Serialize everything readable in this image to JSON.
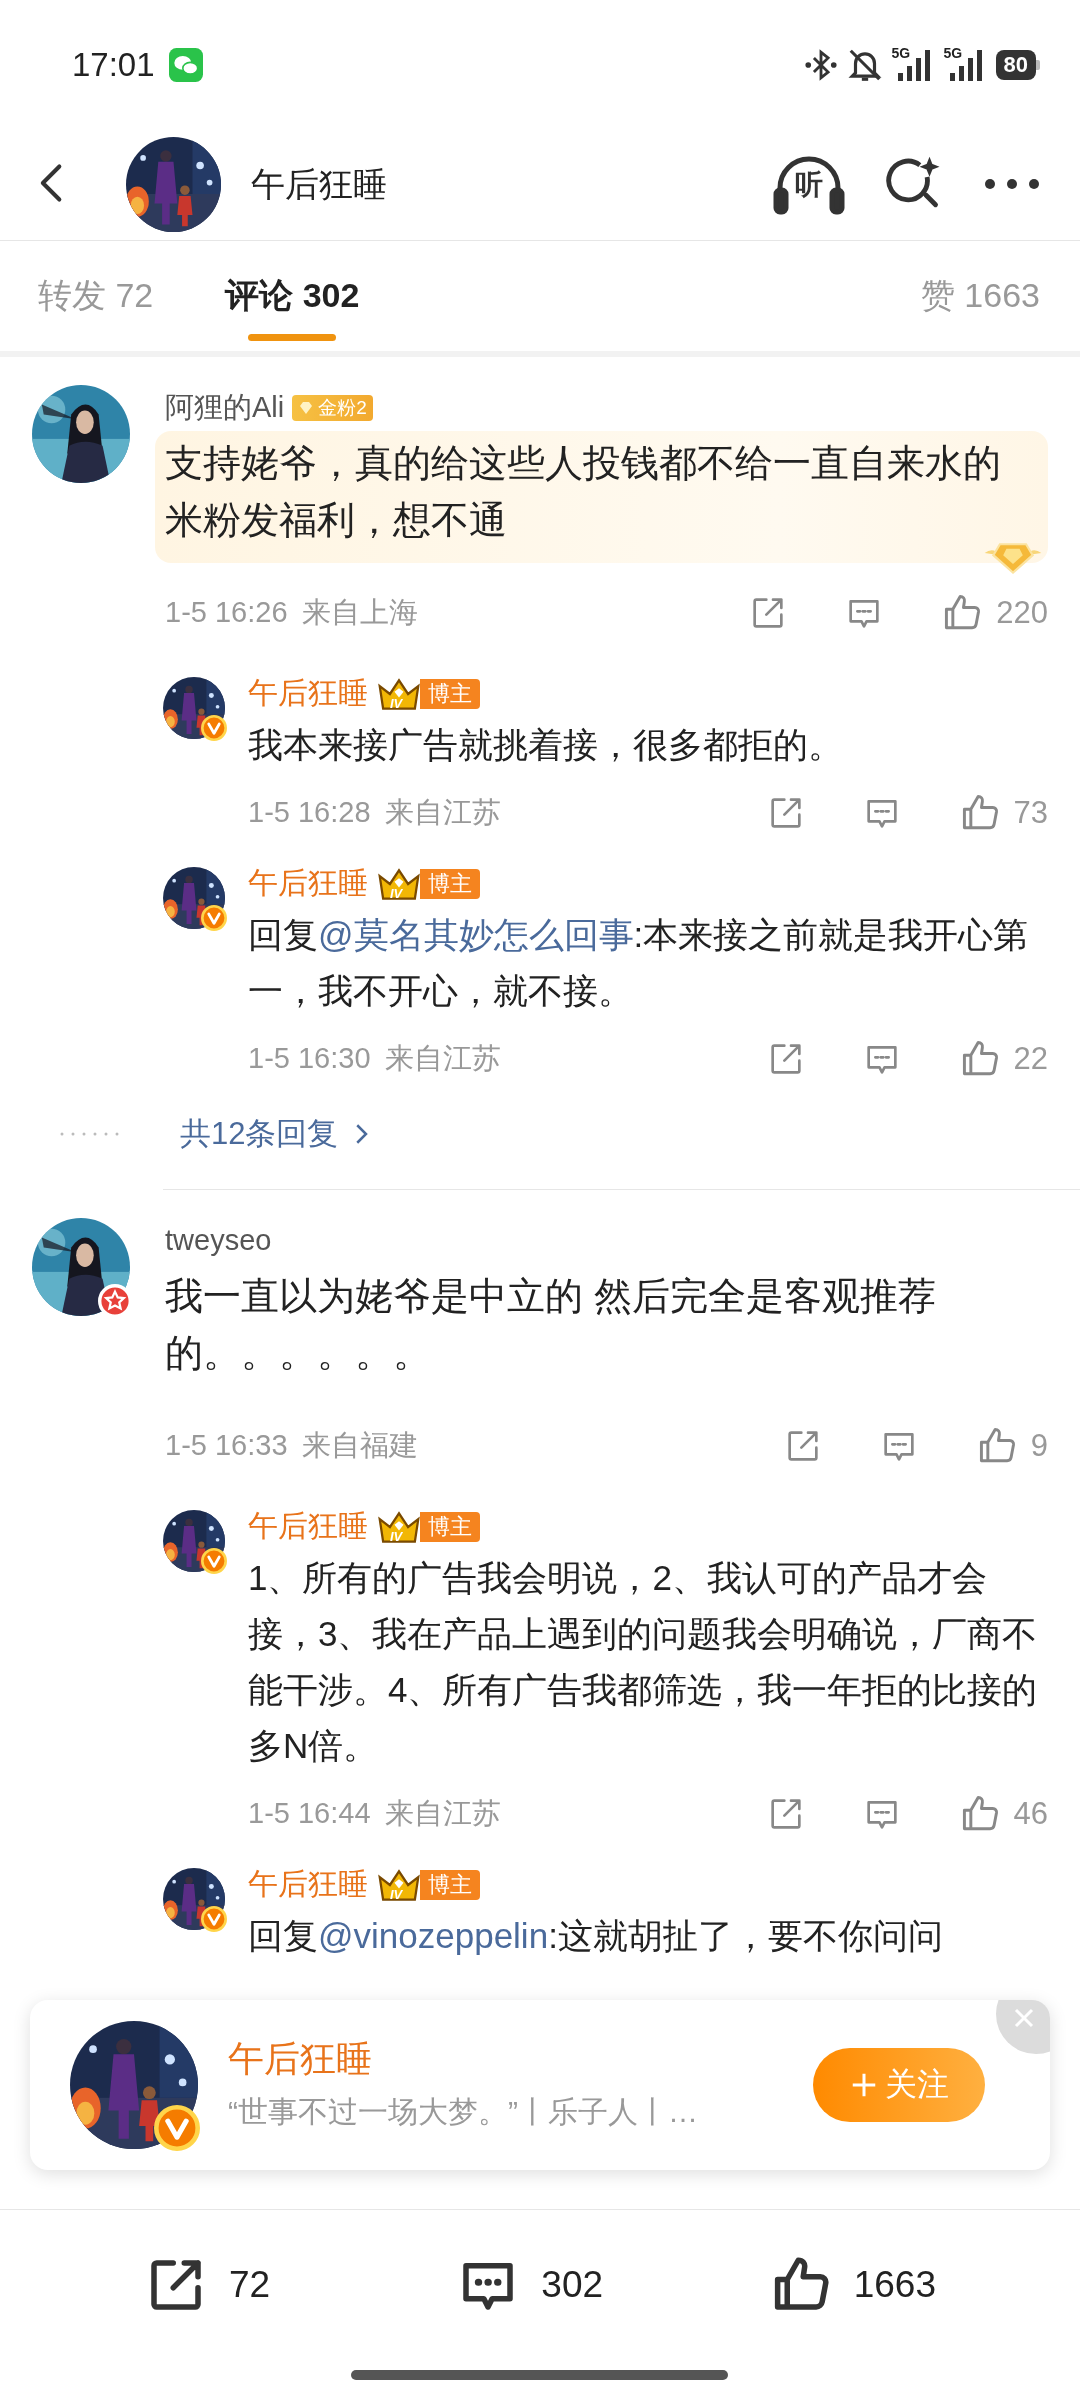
{
  "status_bar": {
    "time": "17:01",
    "signals": [
      "5G",
      "5G"
    ],
    "battery": "80"
  },
  "header": {
    "title": "午后狂睡",
    "listen_label": "听"
  },
  "tabs": [
    {
      "label": "转发",
      "count": "72",
      "selected": false
    },
    {
      "label": "评论",
      "count": "302",
      "selected": true
    }
  ],
  "likes_tab": {
    "label": "赞",
    "count": "1663"
  },
  "comments": [
    {
      "user": "阿狸的Ali",
      "badge": {
        "kind": "fan",
        "text": "金粉2"
      },
      "highlighted": true,
      "segments": [
        {
          "kind": "text",
          "text": "支持姥爷，真的给这些人投钱都不给一直自来水的米粉发福利，想不通"
        }
      ],
      "time": "1-5 16:26",
      "location": "来自上海",
      "likes": "220",
      "replies": [
        {
          "user": "午后狂睡",
          "avatar_badge": {
            "kind": "verified"
          },
          "badge": {
            "kind": "blogger",
            "level": "IV",
            "text": "博主"
          },
          "segments": [
            {
              "kind": "text",
              "text": "我本来接广告就挑着接，很多都拒的。"
            }
          ],
          "time": "1-5 16:28",
          "location": "来自江苏",
          "likes": "73"
        },
        {
          "user": "午后狂睡",
          "avatar_badge": {
            "kind": "verified"
          },
          "badge": {
            "kind": "blogger",
            "level": "IV",
            "text": "博主"
          },
          "segments": [
            {
              "kind": "text",
              "text": "回复"
            },
            {
              "kind": "mention",
              "text": "@莫名其妙怎么回事"
            },
            {
              "kind": "text",
              "text": ":本来接之前就是我开心第一，我不开心，就不接。"
            }
          ],
          "time": "1-5 16:30",
          "location": "来自江苏",
          "likes": "22"
        }
      ],
      "more_replies": "共12条回复"
    },
    {
      "user": "tweyseo",
      "avatar_badge": {
        "kind": "star"
      },
      "highlighted": false,
      "segments": [
        {
          "kind": "text",
          "text": "我一直以为姥爷是中立的 然后完全是客观推荐的。。。。。。"
        }
      ],
      "time": "1-5 16:33",
      "location": "来自福建",
      "likes": "9",
      "replies": [
        {
          "user": "午后狂睡",
          "avatar_badge": {
            "kind": "verified"
          },
          "badge": {
            "kind": "blogger",
            "level": "IV",
            "text": "博主"
          },
          "segments": [
            {
              "kind": "text",
              "text": "1、所有的广告我会明说，2、我认可的产品才会接，3、我在产品上遇到的问题我会明确说，厂商不能干涉。4、所有广告我都筛选，我一年拒的比接的多N倍。"
            }
          ],
          "time": "1-5 16:44",
          "location": "来自江苏",
          "likes": "46"
        },
        {
          "user": "午后狂睡",
          "avatar_badge": {
            "kind": "verified"
          },
          "badge": {
            "kind": "blogger",
            "level": "IV",
            "text": "博主"
          },
          "segments": [
            {
              "kind": "text",
              "text": "回复"
            },
            {
              "kind": "mention",
              "text": "@vinozeppelin"
            },
            {
              "kind": "text",
              "text": ":这就胡扯了，要不你问问"
            }
          ]
        }
      ]
    }
  ],
  "popup": {
    "name": "午后狂睡",
    "avatar_badge": {
      "kind": "verified"
    },
    "bio": "“世事不过一场大梦。”丨乐子人丨…",
    "follow_label": "关注"
  },
  "bottom_bar": [
    {
      "kind": "repost",
      "count": "72"
    },
    {
      "kind": "comment",
      "count": "302"
    },
    {
      "kind": "like",
      "count": "1663"
    }
  ]
}
